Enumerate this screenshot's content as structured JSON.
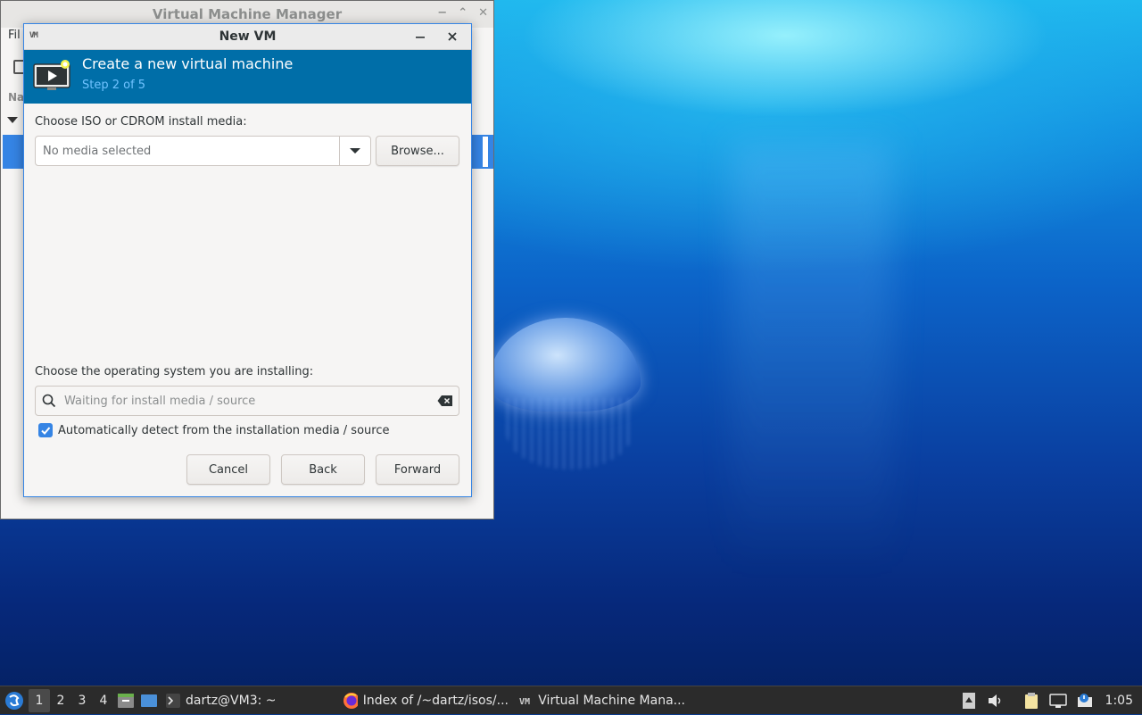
{
  "back_window": {
    "title": "Virtual Machine Manager",
    "menu_file": "Fil",
    "column_header": "Na"
  },
  "dialog": {
    "title": "New VM",
    "banner_title": "Create a new virtual machine",
    "banner_step": "Step 2 of 5",
    "media_label": "Choose ISO or CDROM install media:",
    "media_placeholder": "No media selected",
    "browse_label": "Browse...",
    "os_label": "Choose the operating system you are installing:",
    "os_placeholder": "Waiting for install media / source",
    "auto_detect_label": "Automatically detect from the installation media / source",
    "auto_detect_checked": true,
    "cancel_label": "Cancel",
    "back_label": "Back",
    "forward_label": "Forward"
  },
  "taskbar": {
    "workspaces": [
      "1",
      "2",
      "3",
      "4"
    ],
    "active_workspace": "1",
    "tasks": [
      {
        "label": "dartz@VM3: ~",
        "icon": "terminal-icon"
      },
      {
        "label": "Index of /~dartz/isos/...",
        "icon": "firefox-icon"
      },
      {
        "label": "Virtual Machine Mana...",
        "icon": "virt-manager-icon"
      }
    ],
    "clock": "1:05"
  },
  "colors": {
    "accent": "#3584e4",
    "banner": "#006ea8",
    "banner_step": "#6fc2ff",
    "taskbar": "#2b2b2b"
  }
}
